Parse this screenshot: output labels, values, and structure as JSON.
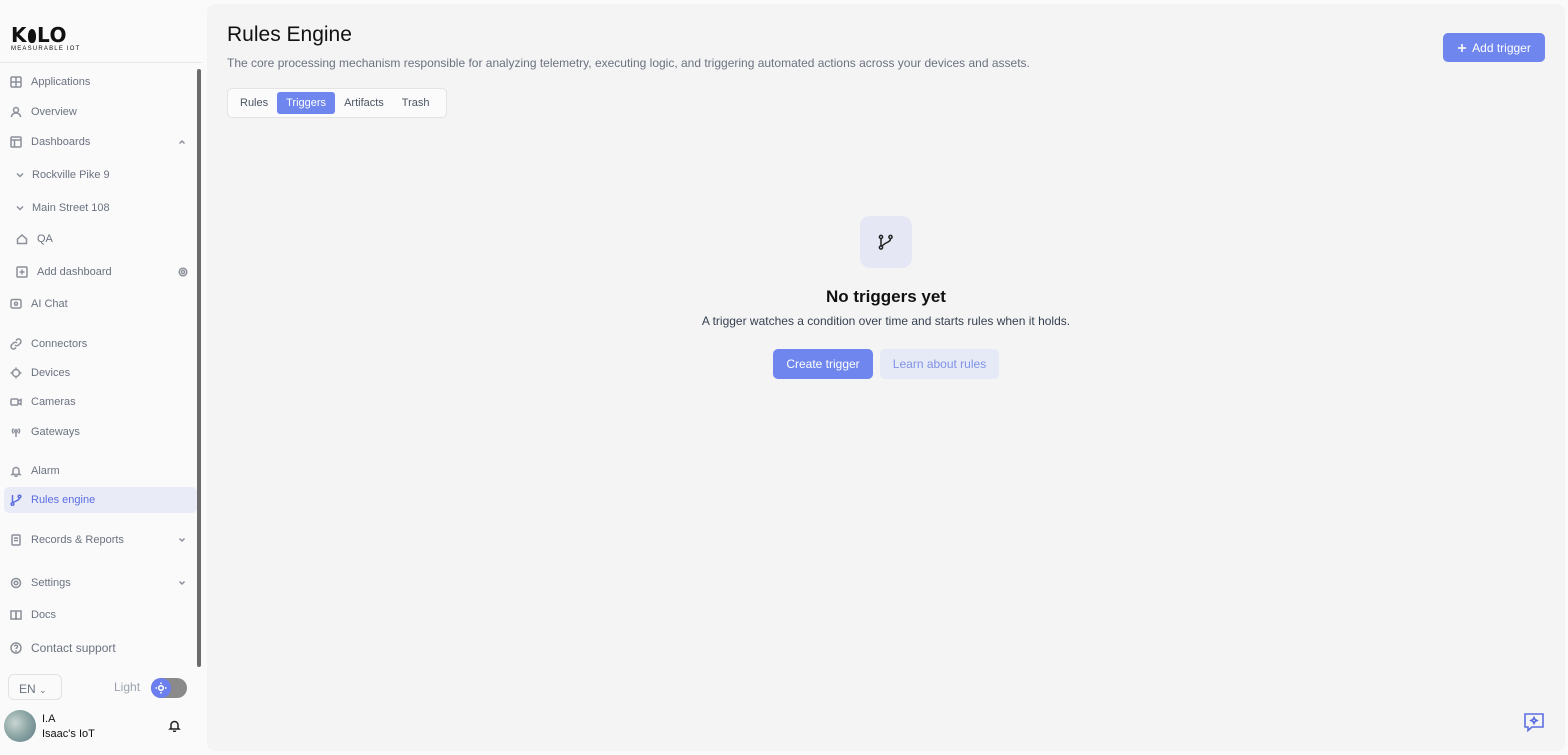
{
  "brand": {
    "name": "K LO",
    "tagline": "MEASURABLE IOT"
  },
  "sidebar": {
    "items": [
      {
        "label": "Applications",
        "icon": "grid-icon"
      },
      {
        "label": "Overview",
        "icon": "user-icon"
      },
      {
        "label": "Dashboards",
        "icon": "layout-icon"
      },
      {
        "label": "Rockville Pike 9",
        "icon": "chevron-down-icon"
      },
      {
        "label": "Main Street 108",
        "icon": "chevron-down-icon"
      },
      {
        "label": "QA",
        "icon": "home-icon"
      },
      {
        "label": "Add dashboard",
        "icon": "plus-square-icon"
      },
      {
        "label": "AI Chat",
        "icon": "chat-icon"
      },
      {
        "label": "Connectors",
        "icon": "link-icon"
      },
      {
        "label": "Devices",
        "icon": "chip-icon"
      },
      {
        "label": "Cameras",
        "icon": "camera-icon"
      },
      {
        "label": "Gateways",
        "icon": "antenna-icon"
      },
      {
        "label": "Alarm",
        "icon": "bell-icon"
      },
      {
        "label": "Rules engine",
        "icon": "git-branch-icon"
      },
      {
        "label": "Records & Reports",
        "icon": "file-icon"
      },
      {
        "label": "Settings",
        "icon": "gear-icon"
      },
      {
        "label": "Docs",
        "icon": "book-icon"
      },
      {
        "label": "Contact support",
        "icon": "help-icon"
      }
    ],
    "language": "EN",
    "theme_label": "Light"
  },
  "user": {
    "name": "I.A",
    "org": "Isaac's IoT"
  },
  "page": {
    "title": "Rules Engine",
    "subtitle": "The core processing mechanism responsible for analyzing telemetry, executing logic, and triggering automated actions across your devices and assets.",
    "add_button": "Add trigger",
    "tabs": [
      "Rules",
      "Triggers",
      "Artifacts",
      "Trash"
    ],
    "active_tab": "Triggers"
  },
  "empty_state": {
    "title": "No triggers yet",
    "description": "A trigger watches a condition over time and starts rules when it holds.",
    "primary_button": "Create trigger",
    "secondary_button": "Learn about rules"
  },
  "colors": {
    "accent": "#6e86ee",
    "active_nav_bg": "#e9ebf7",
    "panel_bg": "#f4f4f4"
  }
}
